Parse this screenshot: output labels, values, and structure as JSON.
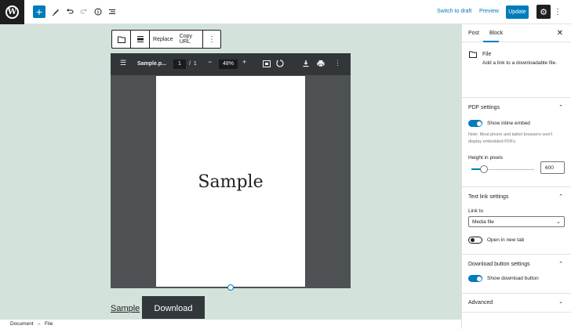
{
  "topbar": {
    "switch_to_draft": "Switch to draft",
    "preview": "Preview",
    "update": "Update",
    "icons": [
      "wordpress-logo",
      "plus-icon",
      "pencil-icon",
      "undo-icon",
      "redo-icon",
      "info-icon",
      "list-view-icon",
      "gear-icon",
      "more-icon"
    ]
  },
  "block_toolbar": {
    "replace": "Replace",
    "copy_url": "Copy URL"
  },
  "pdf_viewer": {
    "title": "Sample.p...",
    "page": "1",
    "page_sep": "/",
    "page_total": "1",
    "zoom": "48%",
    "page_text": "Sample"
  },
  "file_block": {
    "link_text": "Sample",
    "button_text": "Download"
  },
  "breadcrumb": {
    "root": "Document",
    "arrow": "→",
    "current": "File"
  },
  "sidebar": {
    "tabs": [
      "Post",
      "Block"
    ],
    "active_tab": "Block",
    "block_card": {
      "title": "File",
      "description": "Add a link to a downloadable file."
    },
    "pdf_settings": {
      "title": "PDF settings",
      "show_inline_embed": "Show inline embed",
      "show_inline_embed_on": true,
      "note": "Note: Most phone and tablet browsers won't display embedded PDFs.",
      "height_label": "Height in pixels",
      "height_value": "600",
      "height_fraction": 0.2
    },
    "text_link_settings": {
      "title": "Text link settings",
      "link_to_label": "Link to",
      "link_to_value": "Media file",
      "open_new_tab": "Open in new tab",
      "open_new_tab_on": false
    },
    "download_button_settings": {
      "title": "Download button settings",
      "show_download_button": "Show download button",
      "show_download_button_on": true
    },
    "advanced": {
      "title": "Advanced"
    }
  },
  "colors": {
    "accent": "#007cba",
    "canvas_bg": "#d3e3dc",
    "button_dark": "#32373c"
  }
}
